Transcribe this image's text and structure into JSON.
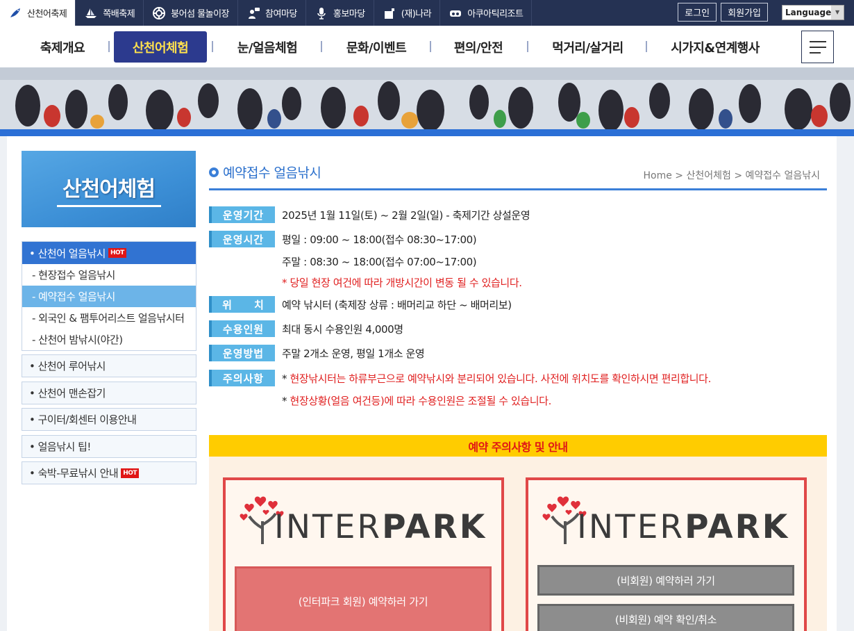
{
  "topnav": [
    {
      "label": "산천어축제",
      "icon": "fish-icon",
      "active": true
    },
    {
      "label": "쪽배축제",
      "icon": "boat-icon"
    },
    {
      "label": "붕어섬 물놀이장",
      "icon": "lifebuoy-icon"
    },
    {
      "label": "참여마당",
      "icon": "chat-user-icon"
    },
    {
      "label": "홍보마당",
      "icon": "microphone-icon"
    },
    {
      "label": "(재)나라",
      "icon": "building-icon"
    },
    {
      "label": "아쿠아틱리조트",
      "icon": "resort-icon"
    }
  ],
  "account": {
    "login": "로그인",
    "signup": "회원가입",
    "language": "Language"
  },
  "mainnav": [
    "축제개요",
    "산천어체험",
    "눈/얼음체험",
    "문화/이벤트",
    "편의/안전",
    "먹거리/살거리",
    "시가지&연계행사"
  ],
  "sidebar": {
    "title": "산천어체험",
    "main_item": "• 산천어 얼음낚시",
    "hot_badge": "HOT",
    "sub_items": [
      "- 현장접수 얼음낚시",
      "- 예약접수 얼음낚시",
      "- 외국인 & 팸투어리스트 얼음낚시터",
      "- 산천어 밤낚시(야간)"
    ],
    "boxes": [
      "• 산천어 루어낚시",
      "• 산천어 맨손잡기",
      "• 구이터/회센터 이용안내",
      "• 얼음낚시 팁!",
      "• 숙박-무료낚시 안내"
    ]
  },
  "page": {
    "title": "예약접수 얼음낚시",
    "breadcrumb": "Home > 산천어체험 > 예약접수 얼음낚시"
  },
  "info": {
    "period_label": "운영기간",
    "period_value": "2025년 1월 11일(토) ~ 2월 2일(일) - 축제기간 상설운영",
    "hours_label": "운영시간",
    "hours_weekday": "평일 : 09:00 ~ 18:00(접수 08:30~17:00)",
    "hours_weekend": "주말 : 08:30 ~ 18:00(접수 07:00~17:00)",
    "hours_note": "* 당일 현장 여건에 따라 개방시간이 변동 될 수 있습니다.",
    "location_label": "위     치",
    "location_value": "예약 낚시터 (축제장 상류 : 배머리교 하단 ~ 배머리보)",
    "capacity_label": "수용인원",
    "capacity_value": "최대 동시 수용인원 4,000명",
    "method_label": "운영방법",
    "method_value": "주말 2개소 운영, 평일 1개소 운영",
    "caution_label": "주의사항",
    "caution_star": "* ",
    "caution_1": "현장낚시터는 하류부근으로 예약낚시와 분리되어 있습니다. 사전에 위치도를 확인하시면 편리합니다.",
    "caution_2": "현장상황(얼음 여건등)에 따라 수용인원은 조절될 수 있습니다."
  },
  "notice": {
    "title": "예약 주의사항 및 안내",
    "logo_light": "INTER",
    "logo_bold": "PARK",
    "member_button": "(인터파크 회원) 예약하러 가기",
    "guest_button": "(비회원) 예약하러 가기",
    "guest_check_button": "(비회원) 예약 확인/취소"
  },
  "colors": {
    "topbar": "#253253",
    "accent": "#3173d2",
    "active_nav": "#2c3a8e",
    "notice_head": "#ffcc00",
    "red": "#e02020"
  }
}
